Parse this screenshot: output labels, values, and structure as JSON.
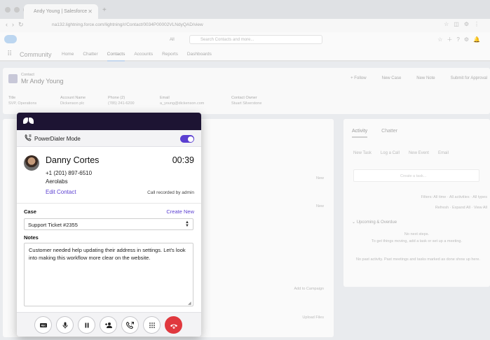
{
  "browser": {
    "tab_title": "Andy Young | Salesforce",
    "url": "na132.lightning.force.com/lightning/r/Contact/0034P00002VLNdyQAD/view"
  },
  "salesforce": {
    "search_scope": "All",
    "search_placeholder": "Search Contacts and more...",
    "app_name": "Community",
    "nav": [
      "Home",
      "Chatter",
      "Contacts",
      "Accounts",
      "Reports",
      "Dashboards"
    ],
    "record": {
      "type": "Contact",
      "name": "Mr Andy Young",
      "actions": [
        "+ Follow",
        "New Case",
        "New Note",
        "Submit for Approval"
      ],
      "fields": [
        {
          "label": "Title",
          "value": "SVP, Operations"
        },
        {
          "label": "Account Name",
          "value": "Dickenson plc"
        },
        {
          "label": "Phone (2)",
          "value": "(785) 241-6200"
        },
        {
          "label": "Email",
          "value": "a_young@dickenson.com"
        },
        {
          "label": "Contact Owner",
          "value": "Stuart Silverstone"
        }
      ]
    },
    "left_card": {
      "new_label": "New",
      "campaign_label": "Add to Campaign",
      "upload_label": "Upload Files"
    },
    "activity": {
      "tabs": [
        "Activity",
        "Chatter"
      ],
      "subtabs": [
        "New Task",
        "Log a Call",
        "New Event",
        "Email"
      ],
      "compose_placeholder": "Create a task...",
      "filters": "Filters: All time · All activities · All types",
      "refresh": "Refresh · Expand All · View All",
      "upcoming": "Upcoming & Overdue",
      "no_next_steps": "No next steps.",
      "get_started": "To get things moving, add a task or set up a meeting.",
      "no_past": "No past activity. Past meetings and tasks marked as done show up here."
    }
  },
  "dialer": {
    "mode_label": "PowerDialer Mode",
    "mode_enabled": true,
    "contact": {
      "name": "Danny Cortes",
      "timer": "00:39",
      "phone": "+1 (201) 897-6510",
      "company": "Aerolabs",
      "edit_label": "Edit Contact",
      "recorded_label": "Call recorded by admin"
    },
    "case": {
      "label": "Case",
      "create_label": "Create New",
      "selected": "Support Ticket #2355"
    },
    "notes": {
      "label": "Notes",
      "value": "Customer needed help updating their address in settings. Let's look into making this workflow more clear on the website."
    },
    "controls": {
      "record_label": "REC"
    },
    "colors": {
      "header_bg": "#1d1433",
      "accent": "#5b3fd1",
      "hangup": "#e0383e"
    }
  }
}
